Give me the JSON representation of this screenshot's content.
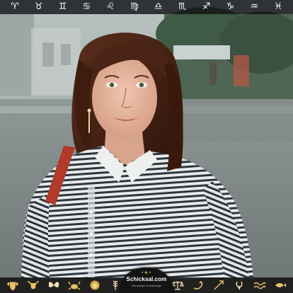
{
  "zodiac_bar": {
    "signs": [
      {
        "glyph": "♈",
        "icon": "aries-icon"
      },
      {
        "glyph": "♉",
        "icon": "taurus-icon"
      },
      {
        "glyph": "♊",
        "icon": "gemini-icon"
      },
      {
        "glyph": "♋",
        "icon": "cancer-icon"
      },
      {
        "glyph": "♌",
        "icon": "leo-icon"
      },
      {
        "glyph": "♍",
        "icon": "virgo-icon"
      },
      {
        "glyph": "♎",
        "icon": "libra-icon"
      },
      {
        "glyph": "♏",
        "icon": "scorpio-icon"
      },
      {
        "glyph": "♐",
        "icon": "sagittarius-icon"
      },
      {
        "glyph": "♑",
        "icon": "capricorn-icon"
      },
      {
        "glyph": "♒",
        "icon": "aquarius-icon"
      },
      {
        "glyph": "♓",
        "icon": "pisces-icon"
      }
    ]
  },
  "logo": {
    "name": "Schicksal.com",
    "stars": "•★•",
    "tagline": "Horoskope & Astrologie"
  },
  "colors": {
    "bar_background": "#141414",
    "icon_gold": "#e6c16a",
    "icon_white": "#ffffff"
  },
  "bottom_icons_left": [
    "ram-head-icon",
    "bull-head-icon",
    "butterfly-icon",
    "crab-icon",
    "lion-head-icon",
    "wheat-icon"
  ],
  "bottom_icons_right": [
    "scales-icon",
    "scorpion-icon",
    "archer-icon",
    "goat-icon",
    "water-waves-icon",
    "fish-icon"
  ]
}
